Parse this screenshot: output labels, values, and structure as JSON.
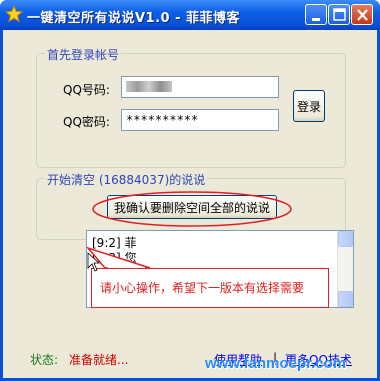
{
  "window": {
    "title": "一键清空所有说说V1.0 - 菲菲博客"
  },
  "login_group": {
    "legend": "首先登录帐号",
    "qq_number_label": "QQ号码:",
    "qq_number_value": "",
    "qq_password_label": "QQ密码:",
    "qq_password_value": "**********",
    "login_button": "登录"
  },
  "clear_group": {
    "legend": "开始清空 (16884037)的说说",
    "confirm_button": "我确认要删除空间全部的说说"
  },
  "log": {
    "lines": [
      "[9:2] 菲",
      "[9:3] 您"
    ]
  },
  "annotation": {
    "text": "请小心操作，希望下一版本有选择需要"
  },
  "status": {
    "label": "状态:",
    "value": "准备就绪..."
  },
  "links": {
    "help": "使用帮助",
    "separator": "|",
    "more": "更多QQ技术"
  },
  "watermark": "www.fanmoepr.com",
  "colors": {
    "titlebar": "#0a4fd8",
    "client_bg": "#ece9d8",
    "group_legend": "#2d46b9",
    "annotation": "#e02020",
    "status_label": "#1a7a1a",
    "status_value": "#d10000",
    "link": "#0000ee"
  },
  "icons": [
    "star-icon",
    "minimize-icon",
    "maximize-icon",
    "close-icon",
    "scroll-up-icon",
    "scroll-down-icon"
  ]
}
